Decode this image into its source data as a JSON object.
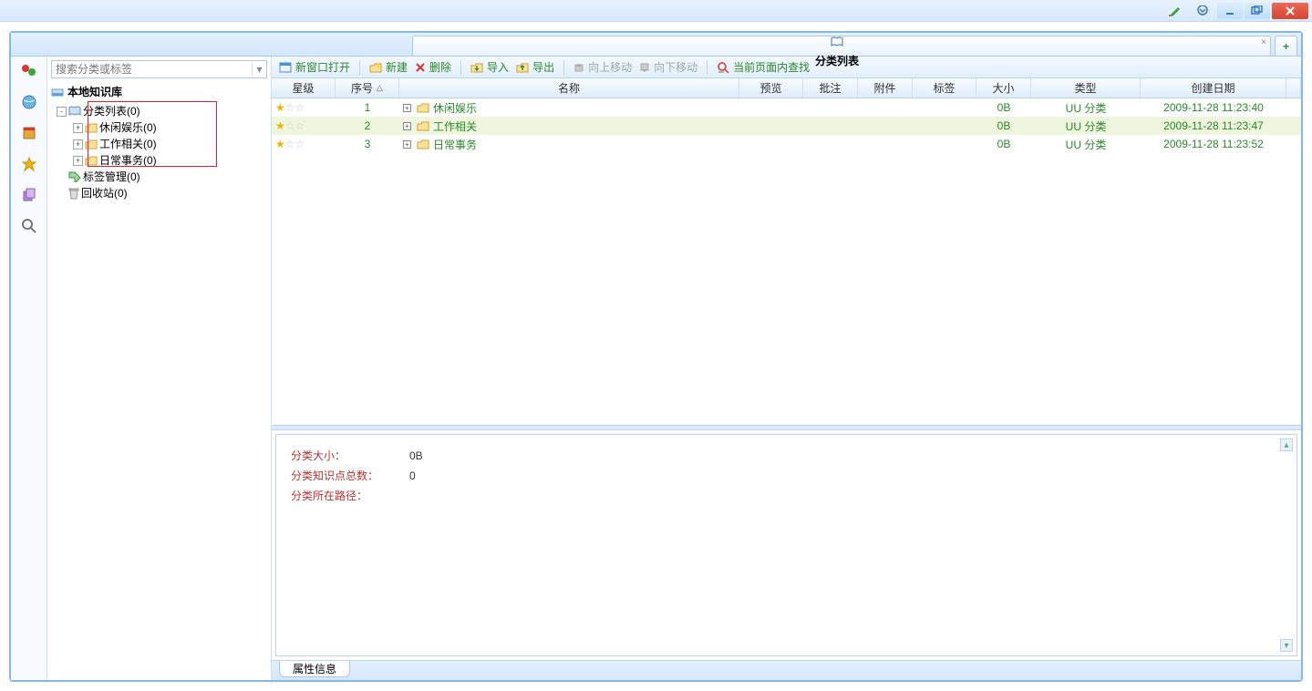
{
  "titlebar": {
    "brush": "brush",
    "chev": "⯆"
  },
  "tabs": {
    "main": "分类列表",
    "close": "×",
    "add": "+"
  },
  "search": {
    "placeholder": "搜索分类或标签"
  },
  "kb_header": "本地知识库",
  "tree": {
    "root": "分类列表(0)",
    "children": [
      "休闲娱乐(0)",
      "工作相关(0)",
      "日常事务(0)"
    ],
    "tags": "标签管理(0)",
    "recycle": "回收站(0)"
  },
  "toolbar": {
    "newwin": "新窗口打开",
    "new": "新建",
    "del": "删除",
    "import": "导入",
    "export": "导出",
    "moveup": "向上移动",
    "movedown": "向下移动",
    "find": "当前页面内查找"
  },
  "columns": {
    "star": "星级",
    "idx": "序号",
    "name": "名称",
    "prev": "预览",
    "note": "批注",
    "att": "附件",
    "tag": "标签",
    "size": "大小",
    "type": "类型",
    "date": "创建日期"
  },
  "rows": [
    {
      "idx": "1",
      "name": "休闲娱乐",
      "size": "0B",
      "type": "UU 分类",
      "date": "2009-11-28 11:23:40",
      "sel": false
    },
    {
      "idx": "2",
      "name": "工作相关",
      "size": "0B",
      "type": "UU 分类",
      "date": "2009-11-28 11:23:47",
      "sel": true
    },
    {
      "idx": "3",
      "name": "日常事务",
      "size": "0B",
      "type": "UU 分类",
      "date": "2009-11-28 11:23:52",
      "sel": false
    }
  ],
  "details": {
    "k_size": "分类大小：",
    "v_size": "0B",
    "k_count": "分类知识点总数：",
    "v_count": "0",
    "k_path": "分类所在路径：",
    "v_path": ""
  },
  "dtab": "属性信息"
}
